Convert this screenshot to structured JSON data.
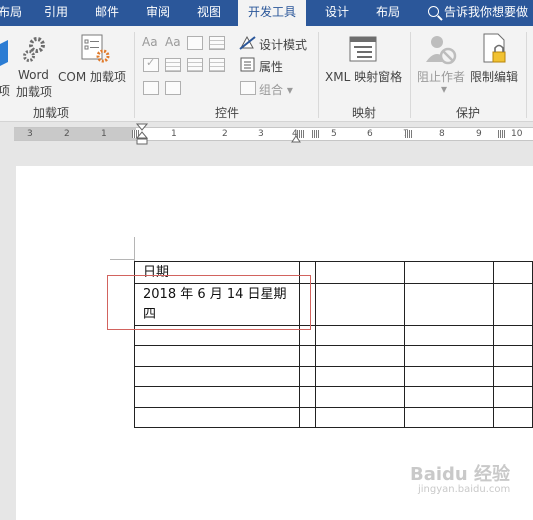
{
  "tabs": {
    "layout_left": "布局",
    "references": "引用",
    "mailings": "邮件",
    "review": "审阅",
    "view": "视图",
    "developer": "开发工具",
    "design": "设计",
    "layout": "布局"
  },
  "tell_me": {
    "placeholder": "告诉我你想要做"
  },
  "ribbon": {
    "addins": {
      "cut_label": "项",
      "word_addins_line1": "Word",
      "word_addins_line2": "加载项",
      "com_addins": "COM 加载项",
      "group_label": "加载项"
    },
    "controls": {
      "design_mode": "设计模式",
      "properties": "属性",
      "group": "组合",
      "group_label": "控件"
    },
    "mapping": {
      "xml_mapping": "XML 映射窗格",
      "group_label": "映射"
    },
    "protect": {
      "block_authors": "阻止作者",
      "restrict_editing": "限制编辑",
      "group_label": "保护"
    }
  },
  "ruler": {
    "numbers_left": [
      "3",
      "2",
      "1",
      "1"
    ],
    "numbers_right": [
      "1",
      "2",
      "3",
      "4",
      "5",
      "6",
      "7",
      "8",
      "9",
      "10"
    ]
  },
  "document": {
    "table": {
      "header_cell": "日期",
      "value_line1": "2018 年 6 月 14 日星期",
      "value_line2": "四"
    }
  },
  "watermark": {
    "brand": "Baidu 经验",
    "url": "jingyan.baidu.com"
  },
  "colors": {
    "tab_bar": "#2b579a",
    "ribbon_bg": "#f3f3f3",
    "highlight_box": "#d2635e"
  }
}
